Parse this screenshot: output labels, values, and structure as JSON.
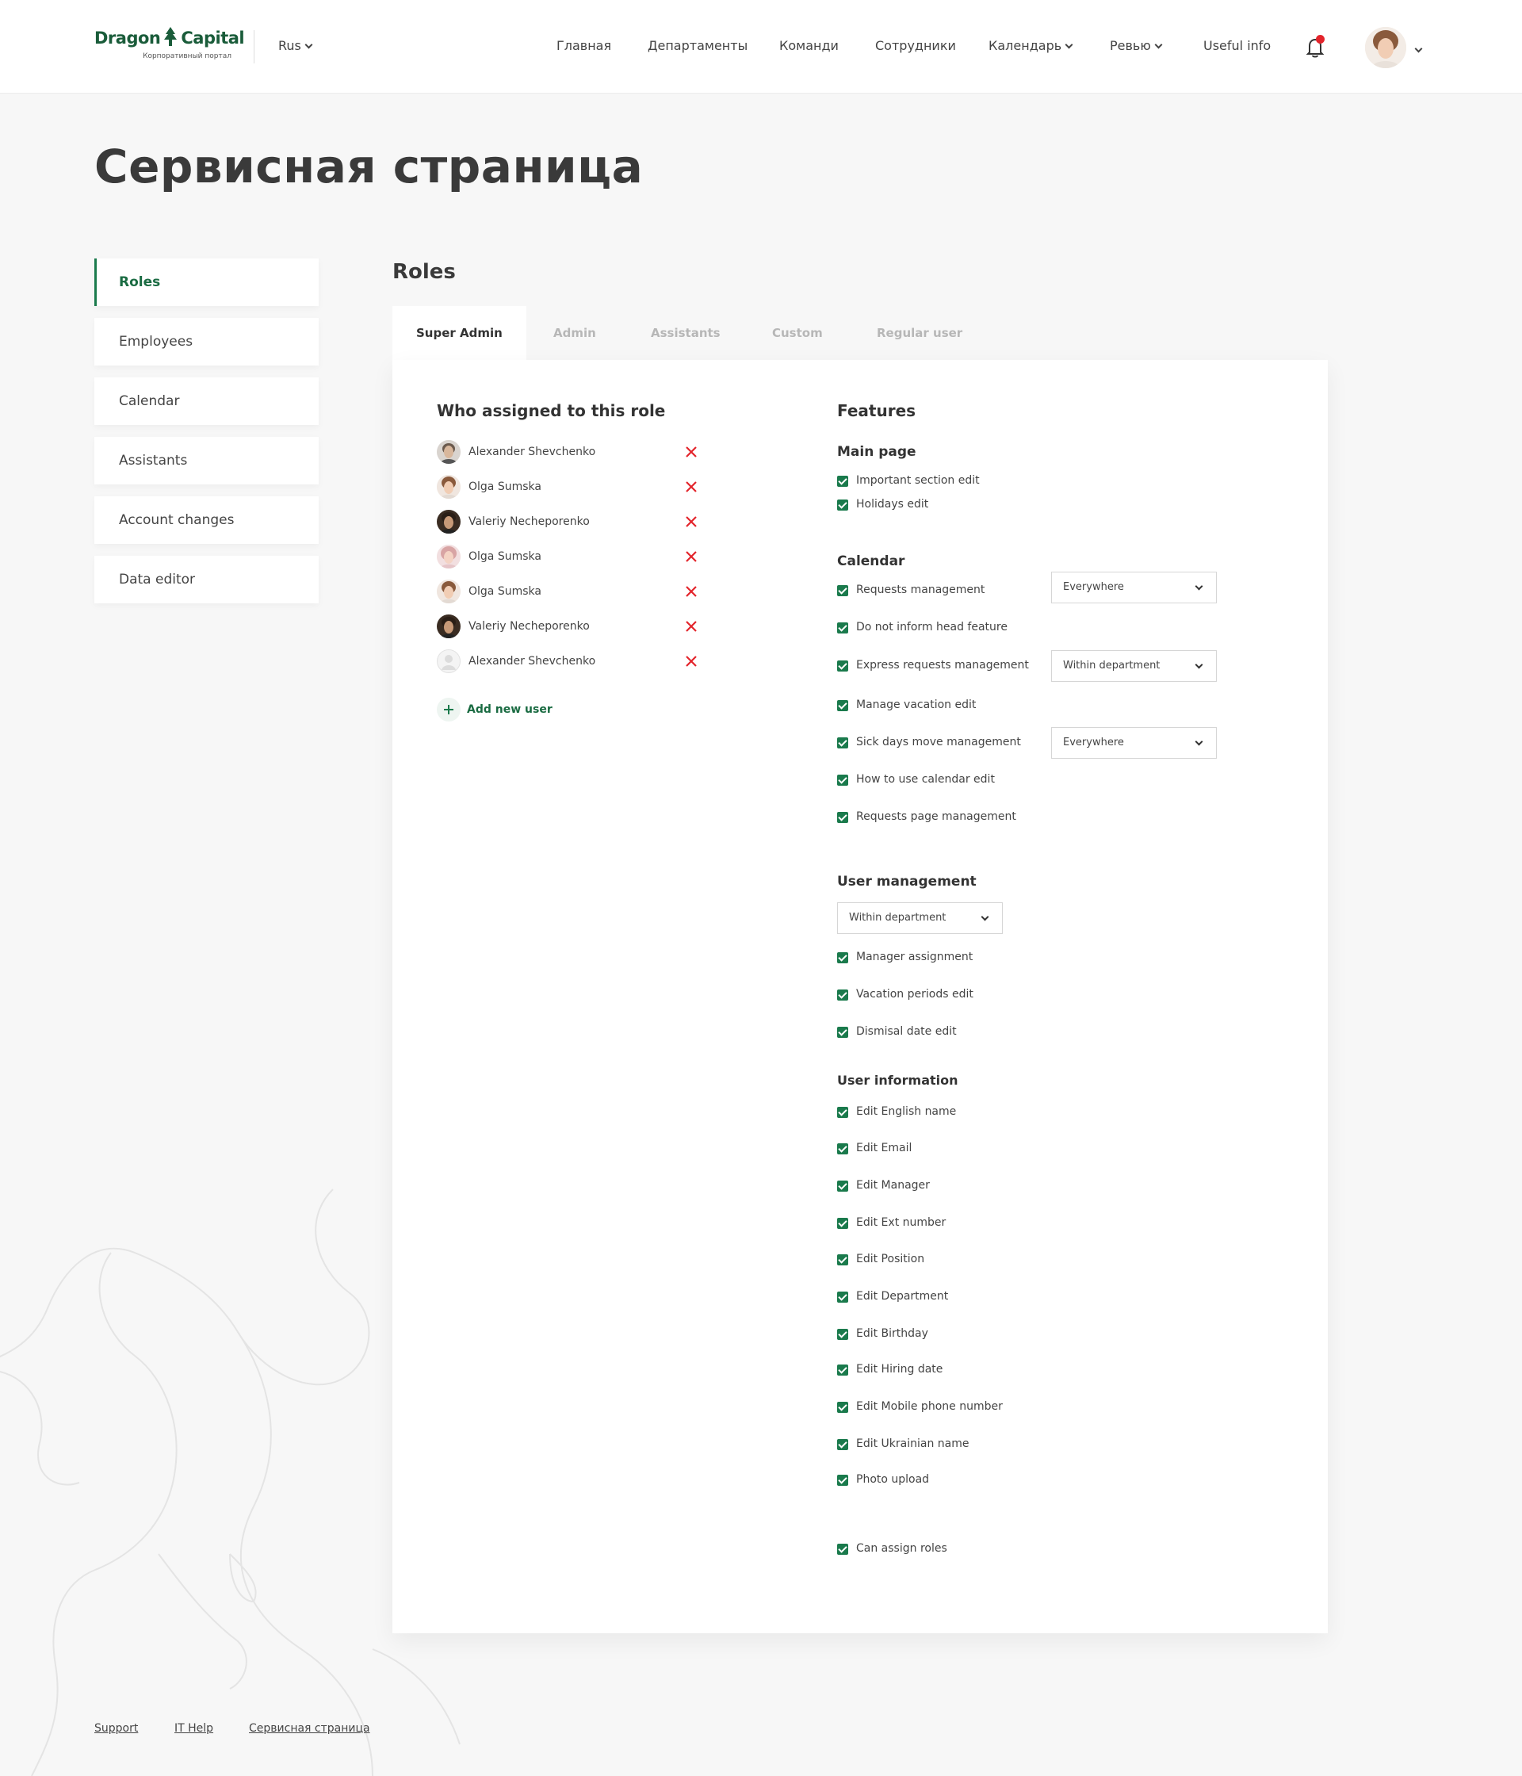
{
  "brand": {
    "name_left": "Dragon",
    "name_right": "Capital",
    "subtitle": "Корпоративный портал",
    "color": "#1a5c3a"
  },
  "header": {
    "language": "Rus",
    "nav": [
      "Главная",
      "Департаменты",
      "Команди",
      "Сотрудники",
      "Календарь",
      "Ревью",
      "Useful info"
    ],
    "icons": {
      "notifications": "bell-icon",
      "profile": "avatar"
    }
  },
  "page_title": "Сервисная страница",
  "sidebar": {
    "items": [
      "Roles",
      "Employees",
      "Calendar",
      "Assistants",
      "Account changes",
      "Data editor"
    ],
    "active": "Roles"
  },
  "roles": {
    "title": "Roles",
    "tabs": [
      "Super Admin",
      "Admin",
      "Assistants",
      "Custom",
      "Regular user"
    ],
    "active_tab": "Super Admin",
    "assigned": {
      "title": "Who assigned to this role",
      "users": [
        "Alexander Shevchenko",
        "Olga Sumska",
        "Valeriy Necheporenko",
        "Olga Sumska",
        "Olga Sumska",
        "Valeriy Necheporenko",
        "Alexander Shevchenko"
      ],
      "add_label": "Add new user"
    },
    "features": {
      "title": "Features",
      "main_page": {
        "title": "Main page",
        "items": [
          "Important section edit",
          "Holidays edit"
        ]
      },
      "calendar": {
        "title": "Calendar",
        "items": [
          "Requests management",
          "Do not inform head feature",
          "Express requests management",
          "Manage vacation edit",
          "Sick days move management",
          "How to use calendar edit",
          "Requests page management"
        ],
        "selects": [
          "Everywhere",
          "Within department",
          "Everywhere"
        ]
      },
      "user_management": {
        "title": "User management",
        "scope": "Within department",
        "items": [
          "Manager assignment",
          "Vacation periods edit",
          "Dismisal date edit"
        ]
      },
      "user_information": {
        "title": "User information",
        "items": [
          "Edit English name",
          "Edit Email",
          "Edit Manager",
          "Edit Ext number",
          "Edit Position",
          "Edit Department",
          "Edit Birthday",
          "Edit Hiring date",
          "Edit Mobile phone number",
          "Edit Ukrainian name",
          "Photo upload"
        ]
      },
      "extra": {
        "label": "Can assign roles"
      }
    }
  },
  "footer": {
    "links": [
      "Support",
      "IT Help",
      "Сервисная страница"
    ]
  },
  "colors": {
    "accent": "#1a7a4c",
    "remove": "#e3242b",
    "background": "#f7f7f7"
  }
}
